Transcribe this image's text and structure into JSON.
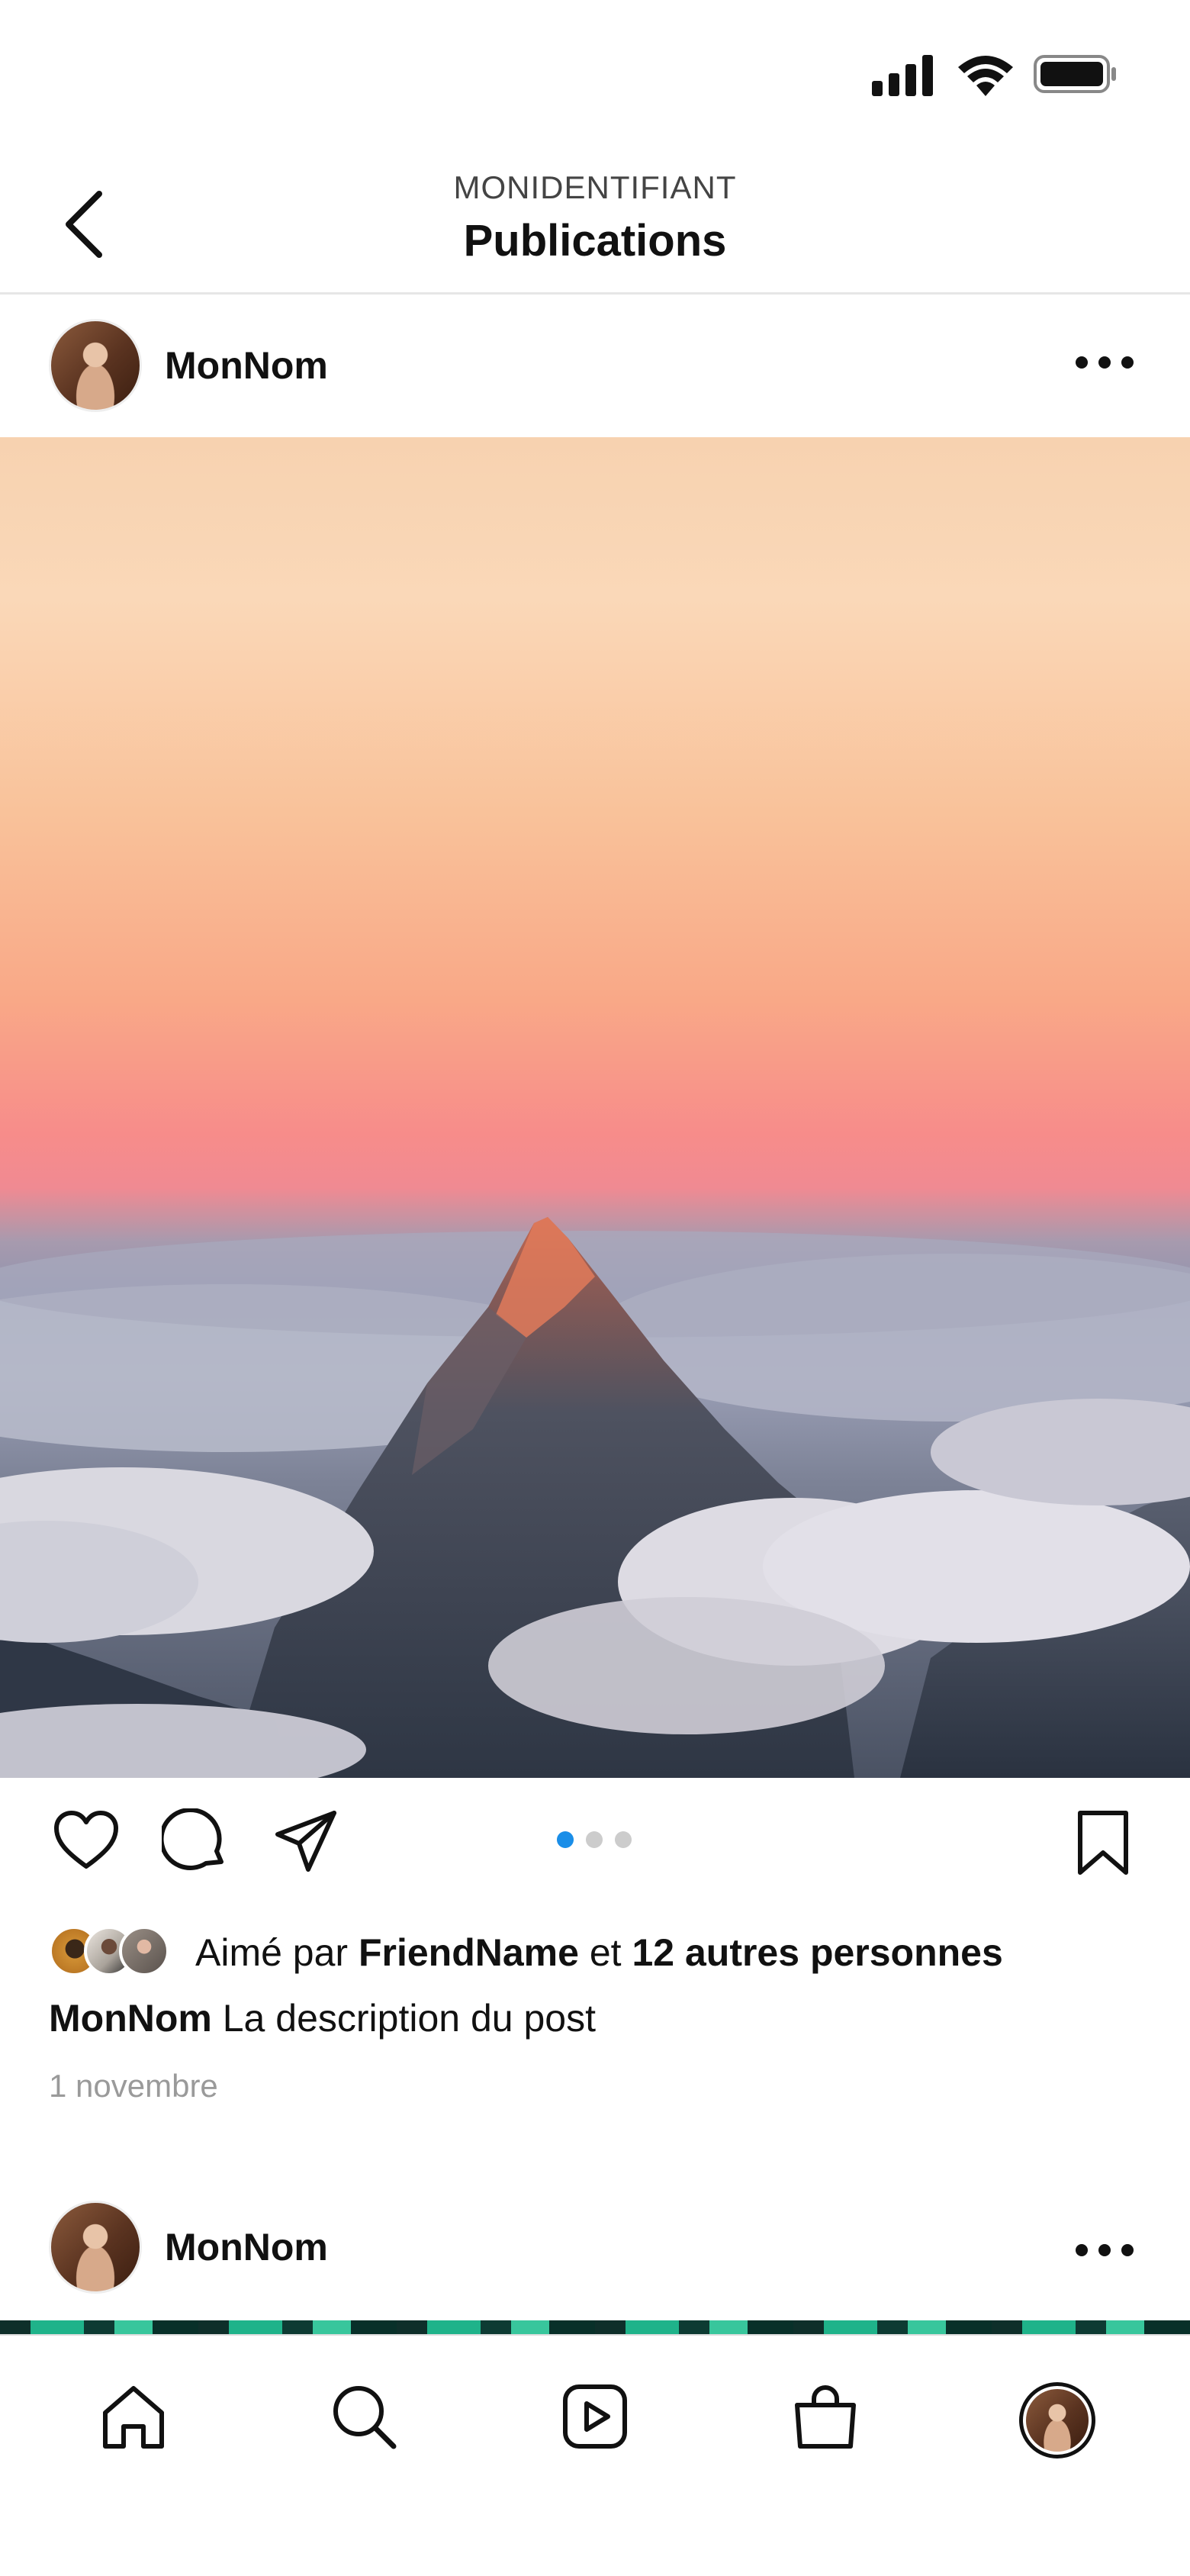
{
  "status_bar": {
    "signal_icon": "cellular-signal-icon",
    "wifi_icon": "wifi-icon",
    "battery_icon": "battery-icon"
  },
  "header": {
    "back_icon": "chevron-left-icon",
    "account_id": "MONIDENTIFIANT",
    "title": "Publications"
  },
  "post": {
    "username": "MonNom",
    "more_icon": "more-horizontal-icon",
    "image_subject": "mountain-peak-above-clouds",
    "carousel": {
      "count": 3,
      "active_index": 0,
      "active_color": "#1a8ee8",
      "inactive_color": "#cccccc"
    },
    "actions": [
      "heart-icon",
      "comment-icon",
      "share-icon",
      "bookmark-icon"
    ],
    "likes": {
      "prefix": "Aimé par",
      "friend": "FriendName",
      "connector": "et",
      "others": "12 autres personnes"
    },
    "caption": {
      "username": "MonNom",
      "text": "La description du post"
    },
    "date": "1 novembre"
  },
  "next_post": {
    "username": "MonNom"
  },
  "tab_bar": {
    "items": [
      "home-icon",
      "search-icon",
      "reels-icon",
      "shop-icon",
      "profile-avatar"
    ]
  },
  "colors": {
    "text": "#111111",
    "muted": "#9a9a9a",
    "accent": "#1a8ee8"
  }
}
